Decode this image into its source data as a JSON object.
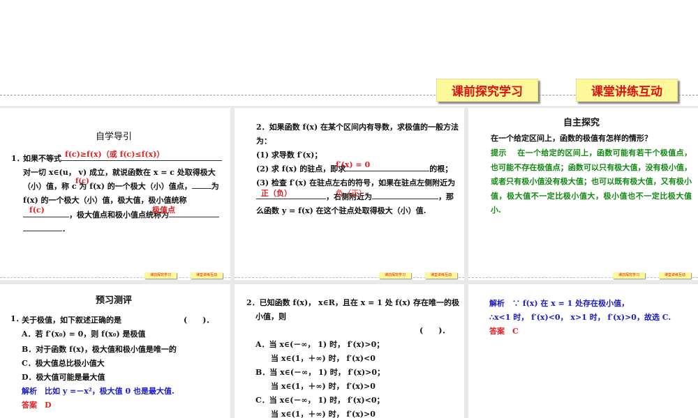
{
  "header": {
    "nav": [
      "课前探究学习",
      "课堂讲练互动"
    ],
    "accent": "#e01010",
    "button_bg": "#fdf89a"
  },
  "slide1": {
    "title": "自学导引",
    "num": "1．",
    "l1": "如果不等式",
    "a1": "f(c)≥f(x)（或 f(c)≤f(x)）",
    "l2": "对一切 x∈(u， v) 成立，就说函数在 x = c 处取得极大",
    "l3a": "（小）值，称",
    "a2": "c",
    "l3b": "为 f(x) 的一个极大（小）值点，",
    "l3c": "为",
    "a3": "f(c)",
    "l4": "f(x) 的一个极大（小）值，极大值，极小值统称",
    "a4": "f(c)",
    "l5": "，极大值点和极小值点统称为",
    "a5": "极值点",
    "l6": "．"
  },
  "slide2": {
    "l1": "2．如果函数 f(x) 在某个区间内有导数，求极值的一般方法",
    "l2": "为：",
    "l3": "(1) 求导数 f′(x)；",
    "l4a": "(2) 求 f(x) 的驻点，即求",
    "a1": "f′(x) = 0",
    "l4b": "的根；",
    "l5": "(3) 检查 f′(x) 在驻点左右的符号，如果在驻点左侧附近为",
    "a2": "正（负）",
    "l6a": "，右侧附近为",
    "a3": "负（正）",
    "l6b": "，那",
    "l7": "么函数 y = f(x) 在这个驻点处取得极大（小）值."
  },
  "slide3": {
    "title": "自主探究",
    "question": "在一个给定区间上，函数的极值有怎样的情形？",
    "hint_label": "提示",
    "hint": "在一个给定的区间上，函数可能有若干个极值点，也可能不存在极值点；函数可以只有极大值，没有极小值，或者只有极小值没有极大值；也可以既有极大值，又有极小值，极大值不一定比极小值大，极小值也不一定比极大值小."
  },
  "slide4": {
    "title": "预习测评",
    "num": "1．",
    "q": "关于极值，如下叙述正确的是",
    "paren": "(　　)．",
    "options": [
      "A．若 f′(x₀) = 0，则 f(x₀) 是极值",
      "B．对于函数 f(x)，极大值和极小值是唯一的",
      "C．极大值总比极小值大",
      "D．极大值可能是最大值"
    ],
    "analysis_label": "解析",
    "analysis": "比如 y =－x²，极大值 0 也是最大值.",
    "answer_label": "答案",
    "answer": "D"
  },
  "slide5": {
    "q1": "2．已知函数 f(x)， x∈R，且在 x = 1 处 f(x) 存在唯一的极",
    "q2": "小值，则",
    "paren": "(　　)．",
    "options": [
      "A．当 x∈(－∞， 1) 时， f′(x)>0；",
      "　　当 x∈(1，＋∞) 时， f′(x)<0",
      "B．当 x∈(－∞， 1) 时， f′(x)>0；",
      "　　当 x∈(1，＋∞) 时， f′(x)>0",
      "C．当 x∈(－∞， 1) 时， f′(x)<0；",
      "　　当 x∈(1，＋∞) 时， f′(x)>0"
    ]
  },
  "slide6": {
    "analysis_label": "解析",
    "a1": "∵ f(x) 在 x = 1 处存在极小值，",
    "a2": "∴x<1 时， f′(x)<0， x>1 时， f′(x)>0，故选 C.",
    "answer_label": "答案",
    "answer": "C"
  }
}
